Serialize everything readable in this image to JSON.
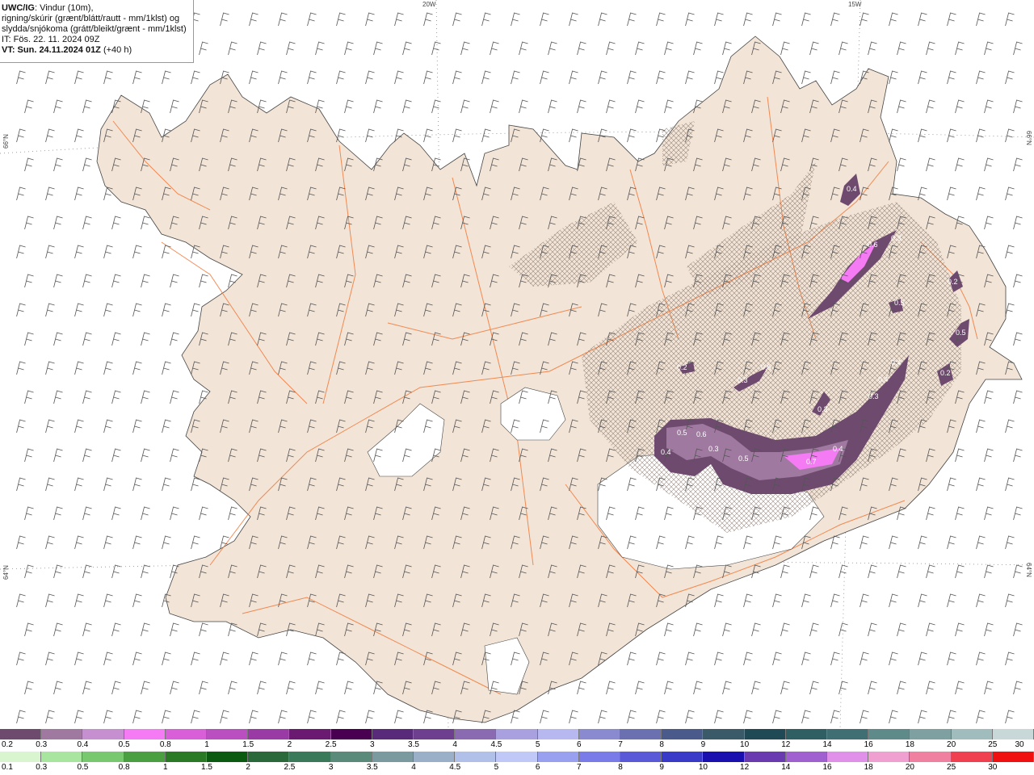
{
  "header": {
    "model": "UWC/IG",
    "line1": ": Vindur (10m),",
    "line2": "rigning/skúrir (grænt/blátt/rautt - mm/1klst) og",
    "line3": "slydda/snjókoma (grátt/bleikt/grænt - mm/1klst)",
    "line4": "IT: Fös. 22. 11. 2024 09Z",
    "line5": "VT: Sun. 24.11.2024 01Z",
    "line5b": " (+40 h)"
  },
  "grid_labels": {
    "lon_20": "20W",
    "lon_15": "15W",
    "lat_66_left": "66°N",
    "lat_66_right": "66°N",
    "lat_64_left": "64°N",
    "lat_64_right": "64°N"
  },
  "colors": {
    "land": "#f2e4d6",
    "roads": "#f07a3c",
    "ice": "#ffffff",
    "sea": "#ffffff"
  },
  "precip_labels": [
    {
      "text": "0.4",
      "id": "p1"
    },
    {
      "text": "0.5",
      "id": "p2"
    },
    {
      "text": "0.3",
      "id": "p3"
    },
    {
      "text": "0.6",
      "id": "p4"
    },
    {
      "text": "0.3",
      "id": "p5"
    },
    {
      "text": "0.5",
      "id": "p6"
    },
    {
      "text": "0.2",
      "id": "p7"
    },
    {
      "text": "0.3",
      "id": "p8"
    },
    {
      "text": "0.5",
      "id": "p9"
    },
    {
      "text": "0.4",
      "id": "p10"
    },
    {
      "text": "0.3",
      "id": "p11"
    },
    {
      "text": "0.4",
      "id": "p12"
    },
    {
      "text": "0.3",
      "id": "p13"
    },
    {
      "text": "0.4",
      "id": "p14"
    },
    {
      "text": "0.5",
      "id": "p15"
    },
    {
      "text": "0.6",
      "id": "p16"
    },
    {
      "text": "0.2",
      "id": "p17"
    },
    {
      "text": "0.5",
      "id": "p18"
    },
    {
      "text": "0.7",
      "id": "p19"
    },
    {
      "text": "0.4",
      "id": "p20"
    },
    {
      "text": "0.2",
      "id": "p21"
    }
  ],
  "snow_scale": {
    "labels": [
      "0.2",
      "0.3",
      "0.4",
      "0.5",
      "0.8",
      "1",
      "1.5",
      "2",
      "2.5",
      "3",
      "3.5",
      "4",
      "4.5",
      "5",
      "6",
      "7",
      "8",
      "9",
      "10",
      "12",
      "14",
      "16",
      "18",
      "20",
      "25",
      "30"
    ],
    "colors": [
      "#6e4a6e",
      "#a079a0",
      "#c58fd0",
      "#f57bf5",
      "#d95fd9",
      "#b94fc0",
      "#9a3aa5",
      "#6a1a70",
      "#4a0050",
      "#5a2a7a",
      "#6f3f8f",
      "#8a6ab0",
      "#a9a0e0",
      "#b8b8f0",
      "#8a8ad0",
      "#6a70b0",
      "#4a5a8a",
      "#3a5a6a",
      "#1f4a55",
      "#2f5f62",
      "#3f6f72",
      "#5f8a8a",
      "#7fa0a0",
      "#a0bcbc",
      "#c8d8d8"
    ]
  },
  "rain_scale": {
    "labels": [
      "0.1",
      "0.3",
      "0.5",
      "0.8",
      "1",
      "1.5",
      "2",
      "2.5",
      "3",
      "3.5",
      "4",
      "4.5",
      "5",
      "6",
      "7",
      "8",
      "9",
      "10",
      "12",
      "14",
      "16",
      "18",
      "20",
      "25",
      "30"
    ],
    "colors": [
      "#d8f5d0",
      "#a8e6a0",
      "#78c870",
      "#4aa040",
      "#2a7a25",
      "#0a5a10",
      "#2a6a3a",
      "#3a7a5a",
      "#5a8a7a",
      "#7a9aa0",
      "#9ab0c8",
      "#b0c0e8",
      "#c0c8f8",
      "#9aa0f0",
      "#7a7ae8",
      "#5a5ad8",
      "#3a3ac8",
      "#1a10b0",
      "#6a3ab0",
      "#a060d0",
      "#e090e8",
      "#f0a0d0",
      "#f080a0",
      "#f04050",
      "#f01010"
    ]
  }
}
